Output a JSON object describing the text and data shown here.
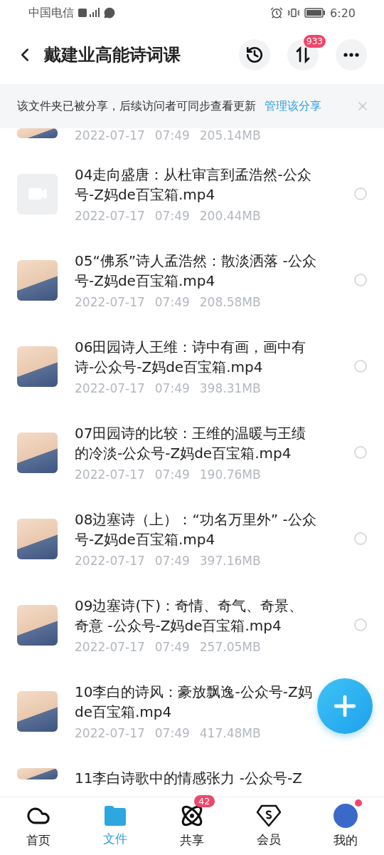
{
  "status_bar": {
    "carrier": "中国电信",
    "time": "6:20"
  },
  "header": {
    "title": "戴建业高能诗词课",
    "transfer_badge": "933"
  },
  "banner": {
    "message": "该文件夹已被分享，后续访问者可同步查看更新",
    "link": "管理该分享"
  },
  "files": [
    {
      "kind": "meta_only",
      "thumb": {
        "kind": "photo"
      },
      "date": "2022-07-17",
      "time": "07:49",
      "size": "205.14MB"
    },
    {
      "kind": "full",
      "thumb": {
        "kind": "video"
      },
      "title": "04走向盛唐：从杜审言到孟浩然-公众号-Z妈de百宝箱.mp4",
      "date": "2022-07-17",
      "time": "07:49",
      "size": "200.44MB",
      "selected": false
    },
    {
      "kind": "full",
      "thumb": {
        "kind": "photo"
      },
      "title": "05“佛系”诗人孟浩然：散淡洒落 -公众号-Z妈de百宝箱.mp4",
      "date": "2022-07-17",
      "time": "07:49",
      "size": "208.58MB",
      "selected": false
    },
    {
      "kind": "full",
      "thumb": {
        "kind": "photo"
      },
      "title": "06田园诗人王维：诗中有画，画中有诗-公众号-Z妈de百宝箱.mp4",
      "date": "2022-07-17",
      "time": "07:49",
      "size": "398.31MB",
      "selected": false
    },
    {
      "kind": "full",
      "thumb": {
        "kind": "photo"
      },
      "title": "07田园诗的比较：王维的温暖与王绩的冷淡-公众号-Z妈de百宝箱.mp4",
      "date": "2022-07-17",
      "time": "07:49",
      "size": "190.76MB",
      "selected": false
    },
    {
      "kind": "full",
      "thumb": {
        "kind": "photo"
      },
      "title": "08边塞诗（上）：“功名万里外” -公众号-Z妈de百宝箱.mp4",
      "date": "2022-07-17",
      "time": "07:49",
      "size": "397.16MB",
      "selected": false
    },
    {
      "kind": "full",
      "thumb": {
        "kind": "photo"
      },
      "title": "09边塞诗(下)：奇情、奇气、奇景、奇意 -公众号-Z妈de百宝箱.mp4",
      "date": "2022-07-17",
      "time": "07:49",
      "size": "257.05MB",
      "selected": false
    },
    {
      "kind": "full",
      "thumb": {
        "kind": "photo"
      },
      "title": "10李白的诗风：豪放飘逸-公众号-Z妈de百宝箱.mp4",
      "date": "2022-07-17",
      "time": "07:49",
      "size": "417.48MB"
    },
    {
      "kind": "title_only",
      "thumb": {
        "kind": "photo"
      },
      "title": "11李白诗歌中的情感张力 -公众号-Z"
    }
  ],
  "tabs": [
    {
      "kind": "home",
      "label": "首页",
      "selected": false
    },
    {
      "kind": "files",
      "label": "文件",
      "selected": true
    },
    {
      "kind": "share",
      "label": "共享",
      "selected": false,
      "badge": "42"
    },
    {
      "kind": "vip",
      "label": "会员",
      "selected": false
    },
    {
      "kind": "me",
      "label": "我的",
      "selected": false,
      "dot": true
    }
  ]
}
